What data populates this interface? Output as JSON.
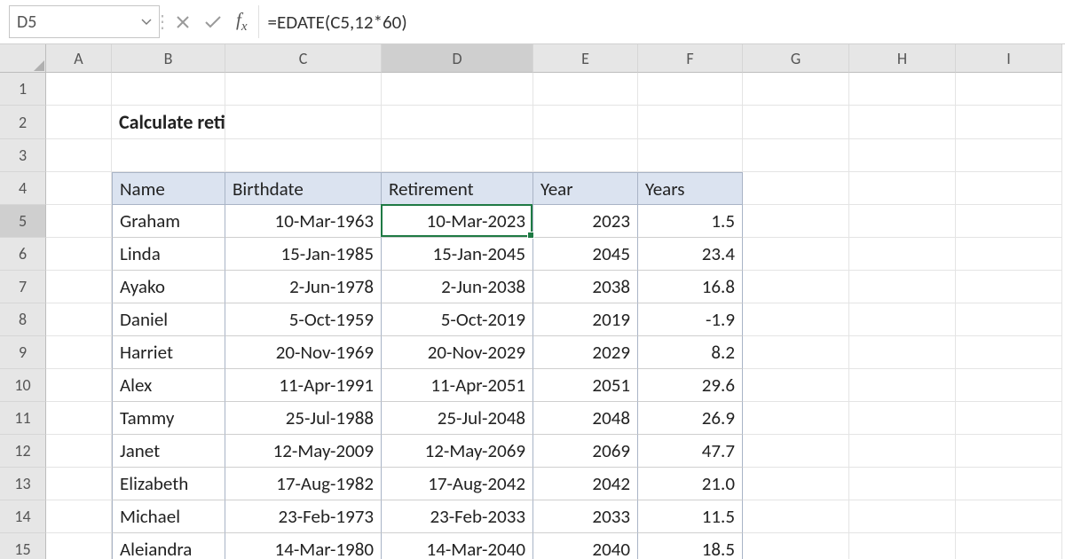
{
  "formula_bar": {
    "name_box": "D5",
    "formula": "=EDATE(C5,12*60)"
  },
  "columns": [
    "A",
    "B",
    "C",
    "D",
    "E",
    "F",
    "G",
    "H",
    "I"
  ],
  "column_widths": {
    "A": 74,
    "B": 128,
    "C": 176,
    "D": 171,
    "E": 118,
    "F": 118,
    "G": 120,
    "H": 120,
    "I": 120
  },
  "rows": [
    "1",
    "2",
    "3",
    "4",
    "5",
    "6",
    "7",
    "8",
    "9",
    "10",
    "11",
    "12",
    "13",
    "14",
    "15"
  ],
  "row_heights": {
    "1": 37,
    "2": 38,
    "3": 37,
    "4": 37,
    "5": 37,
    "6": 37,
    "7": 37,
    "8": 37,
    "9": 37,
    "10": 37,
    "11": 37,
    "12": 37,
    "13": 37,
    "14": 37,
    "15": 37
  },
  "title_cell": {
    "row": "2",
    "col": "B",
    "text": "Calculate retirement date"
  },
  "selected": {
    "row": "5",
    "col": "D"
  },
  "table": {
    "top_row": "4",
    "cols": [
      "B",
      "C",
      "D",
      "E",
      "F"
    ],
    "headers": {
      "B": "Name",
      "C": "Birthdate",
      "D": "Retirement",
      "E": "Year",
      "F": "Years"
    },
    "align": {
      "B": "l",
      "C": "r",
      "D": "r",
      "E": "r",
      "F": "r"
    },
    "data": [
      {
        "B": "Graham",
        "C": "10-Mar-1963",
        "D": "10-Mar-2023",
        "E": "2023",
        "F": "1.5"
      },
      {
        "B": "Linda",
        "C": "15-Jan-1985",
        "D": "15-Jan-2045",
        "E": "2045",
        "F": "23.4"
      },
      {
        "B": "Ayako",
        "C": "2-Jun-1978",
        "D": "2-Jun-2038",
        "E": "2038",
        "F": "16.8"
      },
      {
        "B": "Daniel",
        "C": "5-Oct-1959",
        "D": "5-Oct-2019",
        "E": "2019",
        "F": "-1.9"
      },
      {
        "B": "Harriet",
        "C": "20-Nov-1969",
        "D": "20-Nov-2029",
        "E": "2029",
        "F": "8.2"
      },
      {
        "B": "Alex",
        "C": "11-Apr-1991",
        "D": "11-Apr-2051",
        "E": "2051",
        "F": "29.6"
      },
      {
        "B": "Tammy",
        "C": "25-Jul-1988",
        "D": "25-Jul-2048",
        "E": "2048",
        "F": "26.9"
      },
      {
        "B": "Janet",
        "C": "12-May-2009",
        "D": "12-May-2069",
        "E": "2069",
        "F": "47.7"
      },
      {
        "B": "Elizabeth",
        "C": "17-Aug-1982",
        "D": "17-Aug-2042",
        "E": "2042",
        "F": "21.0"
      },
      {
        "B": "Michael",
        "C": "23-Feb-1973",
        "D": "23-Feb-2033",
        "E": "2033",
        "F": "11.5"
      },
      {
        "B": "Aleiandra",
        "C": "14-Mar-1980",
        "D": "14-Mar-2040",
        "E": "2040",
        "F": "18.5"
      }
    ]
  }
}
